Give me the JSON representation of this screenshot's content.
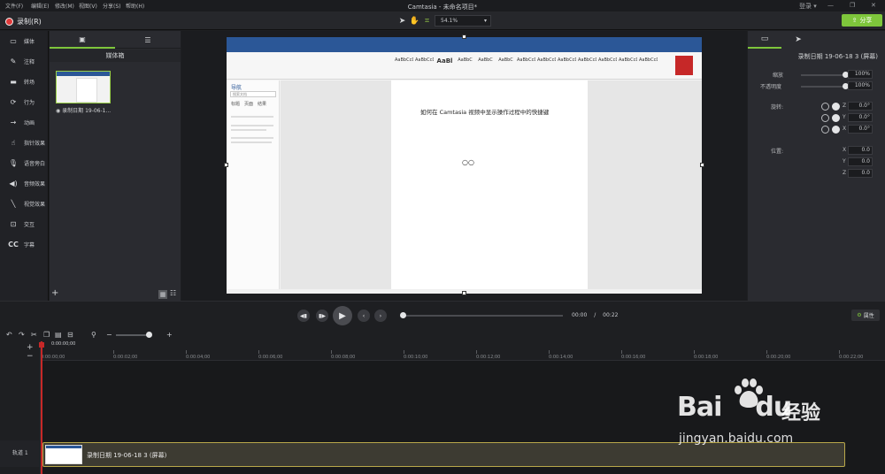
{
  "menu": [
    "文件(F)",
    "编辑(E)",
    "修改(M)",
    "视图(V)",
    "分享(S)",
    "帮助(H)"
  ],
  "window": {
    "title": "Camtasia - 未命名项目*",
    "login": "登录 ▾",
    "share": "分享"
  },
  "record": {
    "label": "录制(R)"
  },
  "zoom": {
    "value": "54.1%"
  },
  "nav": [
    {
      "label": "媒体",
      "icon": "media-icon"
    },
    {
      "label": "注释",
      "icon": "annotation-icon"
    },
    {
      "label": "转场",
      "icon": "transition-icon"
    },
    {
      "label": "行为",
      "icon": "behavior-icon"
    },
    {
      "label": "动画",
      "icon": "animation-icon"
    },
    {
      "label": "指针效果",
      "icon": "cursor-effect-icon"
    },
    {
      "label": "语音旁白",
      "icon": "mic-icon"
    },
    {
      "label": "音频效果",
      "icon": "audio-effect-icon"
    },
    {
      "label": "视觉效果",
      "icon": "visual-effect-icon"
    },
    {
      "label": "交互",
      "icon": "interactive-icon"
    },
    {
      "label": "字幕",
      "icon": "captions-icon"
    }
  ],
  "bin": {
    "title": "媒体箱",
    "clip_label": "录制日期 19-06-1..."
  },
  "canvas": {
    "doc_text": "如何在 Camtasia 视频中显示操作过程中的快捷键",
    "nav_title": "导航",
    "nav_search": "搜索文档",
    "nav_tabs": [
      "标题",
      "页面",
      "结果"
    ],
    "ribbon_styles": [
      "AaBbCcDd",
      "AaBbCcDd",
      "AaBl",
      "AaBbC",
      "AaBbC",
      "AaBbC",
      "AaBbCcD",
      "AaBbCcD",
      "AaBbCcD",
      "AaBbCcDd",
      "AaBbCcDd",
      "AaBbCcDd",
      "AaBbCcDd",
      "AaBbCcDd"
    ]
  },
  "properties": {
    "title": "录制日期 19-06-18 3 (屏幕)",
    "scale_label": "缩放",
    "scale_value": "100%",
    "scale_level": 1.0,
    "opacity_label": "不透明度",
    "opacity_value": "100%",
    "opacity_level": 1.0,
    "rotation_label": "旋转:",
    "rotation": [
      {
        "axis": "Z",
        "value": "0.0°"
      },
      {
        "axis": "Y",
        "value": "0.0°"
      },
      {
        "axis": "X",
        "value": "0.0°"
      }
    ],
    "position_label": "位置:",
    "position": [
      {
        "axis": "X",
        "value": "0.0"
      },
      {
        "axis": "Y",
        "value": "0.0"
      },
      {
        "axis": "Z",
        "value": "0.0"
      }
    ]
  },
  "player": {
    "time_current": "00:00",
    "separator": "/",
    "time_total": "00:22",
    "attr_label": "属性"
  },
  "timeline": {
    "playhead_time": "0:00:00;00",
    "ticks": [
      "0:00:00;00",
      "0:00:02;00",
      "0:00:04;00",
      "0:00:06;00",
      "0:00:08;00",
      "0:00:10;00",
      "0:00:12;00",
      "0:00:14;00",
      "0:00:16;00",
      "0:00:18;00",
      "0:00:20;00",
      "0:00:22;00"
    ],
    "track_label": "轨道 1",
    "clip_label": "录制日期 19-06-18 3 (屏幕)"
  },
  "watermark": {
    "logo": "Bai",
    "logo_tail": "du",
    "cn": "经验",
    "url": "jingyan.baidu.com"
  }
}
